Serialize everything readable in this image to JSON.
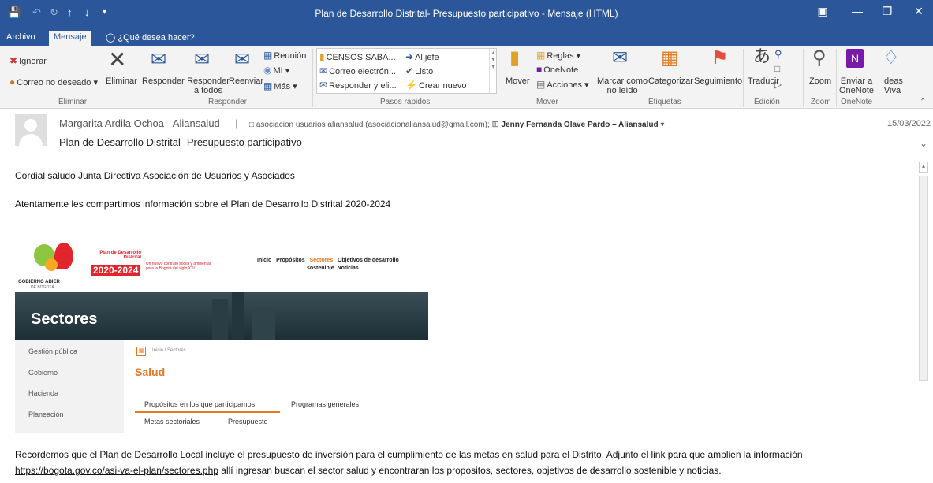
{
  "window": {
    "title": "Plan de Desarrollo Distrital- Presupuesto participativo - Mensaje (HTML)"
  },
  "tabs": {
    "archivo": "Archivo",
    "mensaje": "Mensaje",
    "help": "¿Qué desea hacer?"
  },
  "ribbon": {
    "ignorar": "Ignorar",
    "eliminar": "Eliminar",
    "no_deseado": "Correo no deseado",
    "g_eliminar": "Eliminar",
    "responder": "Responder",
    "resp_todos_1": "Responder",
    "resp_todos_2": "a todos",
    "reenviar": "Reenviar",
    "reunion": "Reunión",
    "mi": "MI",
    "mas": "Más",
    "g_responder": "Responder",
    "qs1": "CENSOS SABA...",
    "qs2": "Correo electrón...",
    "qs3": "Responder y eli...",
    "qs4": "Al jefe",
    "qs5": "Listo",
    "qs6": "Crear nuevo",
    "g_pasos": "Pasos rápidos",
    "mover": "Mover",
    "reglas": "Reglas",
    "onenote": "OneNote",
    "acciones": "Acciones",
    "g_mover": "Mover",
    "marcar_1": "Marcar como",
    "marcar_2": "no leído",
    "categorizar": "Categorizar",
    "seguimiento": "Seguimiento",
    "g_etiquetas": "Etiquetas",
    "traducir": "Traducir",
    "g_edicion": "Edición",
    "zoom": "Zoom",
    "g_zoom": "Zoom",
    "enviar_1": "Enviar a",
    "enviar_2": "OneNote",
    "g_onenote": "OneNote",
    "ideas_1": "Ideas",
    "ideas_2": "Viva"
  },
  "message": {
    "from": "Margarita Ardila Ochoa - Aliansalud",
    "to1": "asociacion usuarios aliansalud (asociacionaliansalud@gmail.com);",
    "to2": "Jenny Fernanda Olave Pardo – Aliansalud",
    "date": "15/03/2022",
    "subject": "Plan de Desarrollo Distrital- Presupuesto participativo"
  },
  "body": {
    "p1": "Cordial saludo Junta Directiva Asociación de Usuarios y Asociados",
    "p2": "Atentamente  les compartimos información sobre el Plan de Desarrollo Distrital 2020-2024",
    "p3": "Recordemos que el Plan de Desarrollo Local incluye el presupuesto de inversión para el cumplimiento de las metas en salud para el Distrito. Adjunto el link para que amplien la información",
    "link": "https://bogota.gov.co/asi-va-el-plan/sectores.php",
    "p4": " allí ingresan buscan el sector salud y encontraran los propositos, sectores, objetivos de desarrollo sostenible y noticias."
  },
  "embedded": {
    "logo_1": "GOBIERNO ABIER",
    "logo_2": "DE BOGOTÁ",
    "plan_1": "Plan de Desarrollo",
    "plan_2": "Distrital",
    "years": "2020-2024",
    "tagline_1": "Un nuevo contrato social y ambiental",
    "tagline_2": "para la Bogotá del siglo XXI",
    "nav_inicio": "Inicio",
    "nav_propositos": "Propósitos",
    "nav_sectores": "Sectores",
    "nav_objetivos": "Objetivos de desarrollo",
    "nav_sostenible": "sostenible",
    "nav_noticias": "Noticias",
    "banner": "Sectores",
    "side": [
      "Gestión pública",
      "Gobierno",
      "Hacienda",
      "Planeación"
    ],
    "crumb": "Inicio / Sectores",
    "heading": "Salud",
    "tab1": "Propósitos en los que participamos",
    "tab2": "Programas generales",
    "tab3": "Metas sectoriales",
    "tab4": "Presupuesto"
  },
  "colors": {
    "brand": "#2b579a",
    "ribbon": "#f3f3f3",
    "accent_red": "#e2242d",
    "accent_orange": "#e87722"
  }
}
